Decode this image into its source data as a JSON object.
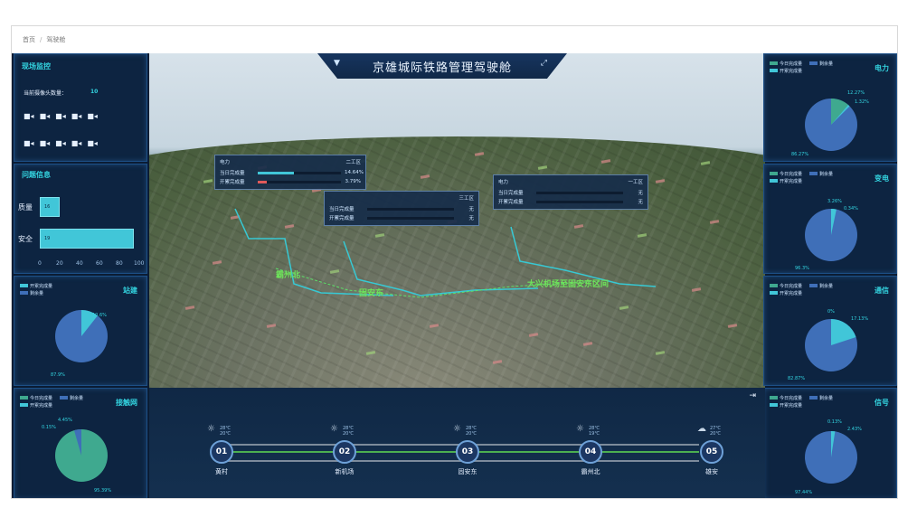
{
  "breadcrumb": {
    "home": "首页",
    "sep": "/",
    "current": "驾驶舱"
  },
  "header": {
    "title": "京雄城际铁路管理驾驶舱"
  },
  "colors": {
    "teal": "#41c6d8",
    "blue": "#3f6fb8",
    "green": "#3fa98f"
  },
  "monitor": {
    "title": "现场监控",
    "camera_count_label": "当前摄像头数量：",
    "camera_count": "10",
    "camera_icon": "video-camera-icon"
  },
  "issues": {
    "title": "问题信息",
    "items": [
      {
        "label": "质量",
        "value": 16
      },
      {
        "label": "安全",
        "value": 19
      }
    ],
    "ticks": [
      "0",
      "20",
      "40",
      "60",
      "80",
      "100"
    ]
  },
  "legend": {
    "today": "今日完成量",
    "remaining": "剩余量",
    "cumulative": "开累完成量"
  },
  "panels": {
    "station": {
      "title": "站建",
      "labels": [
        "10.6%",
        "87.9%"
      ]
    },
    "catenary": {
      "title": "接触网",
      "labels": [
        "4.45%",
        "0.15%",
        "95.39%"
      ]
    },
    "power": {
      "title": "电力",
      "labels": [
        "12.27%",
        "1.32%",
        "86.27%"
      ]
    },
    "substation": {
      "title": "变电",
      "labels": [
        "3.26%",
        "0.34%",
        "96.3%"
      ]
    },
    "comm": {
      "title": "通信",
      "labels": [
        "0%",
        "17.13%",
        "82.87%"
      ]
    },
    "signal": {
      "title": "信号",
      "labels": [
        "0.13%",
        "2.43%",
        "97.44%"
      ]
    }
  },
  "popups": [
    {
      "left_label": "电力",
      "right_label": "二工区",
      "rows": [
        {
          "label": "当日完成量",
          "value": "14.64%",
          "fill": 0.1464
        },
        {
          "label": "开累完成量",
          "value": "3.79%",
          "fill": 0.0379
        }
      ]
    },
    {
      "left_label": "",
      "right_label": "三工区",
      "rows": [
        {
          "label": "当日完成量",
          "value": "无",
          "fill": 0
        },
        {
          "label": "开累完成量",
          "value": "无",
          "fill": 0
        }
      ]
    },
    {
      "left_label": "电力",
      "right_label": "一工区",
      "rows": [
        {
          "label": "当日完成量",
          "value": "无",
          "fill": 0
        },
        {
          "label": "开累完成量",
          "value": "无",
          "fill": 0
        }
      ]
    }
  ],
  "map_labels": [
    "霸州北",
    "固安东",
    "大兴机场至固安东区间"
  ],
  "stations": [
    {
      "num": "01",
      "name": "黄村",
      "weather": "sun-icon",
      "temp_hi": "28℃",
      "temp_lo": "20℃"
    },
    {
      "num": "02",
      "name": "新机场",
      "weather": "sun-icon",
      "temp_hi": "28℃",
      "temp_lo": "20℃"
    },
    {
      "num": "03",
      "name": "固安东",
      "weather": "sun-icon",
      "temp_hi": "28℃",
      "temp_lo": "20℃"
    },
    {
      "num": "04",
      "name": "霸州北",
      "weather": "sun-icon",
      "temp_hi": "28℃",
      "temp_lo": "19℃"
    },
    {
      "num": "05",
      "name": "雄安",
      "weather": "cloud-icon",
      "temp_hi": "27℃",
      "temp_lo": "20℃"
    }
  ]
}
